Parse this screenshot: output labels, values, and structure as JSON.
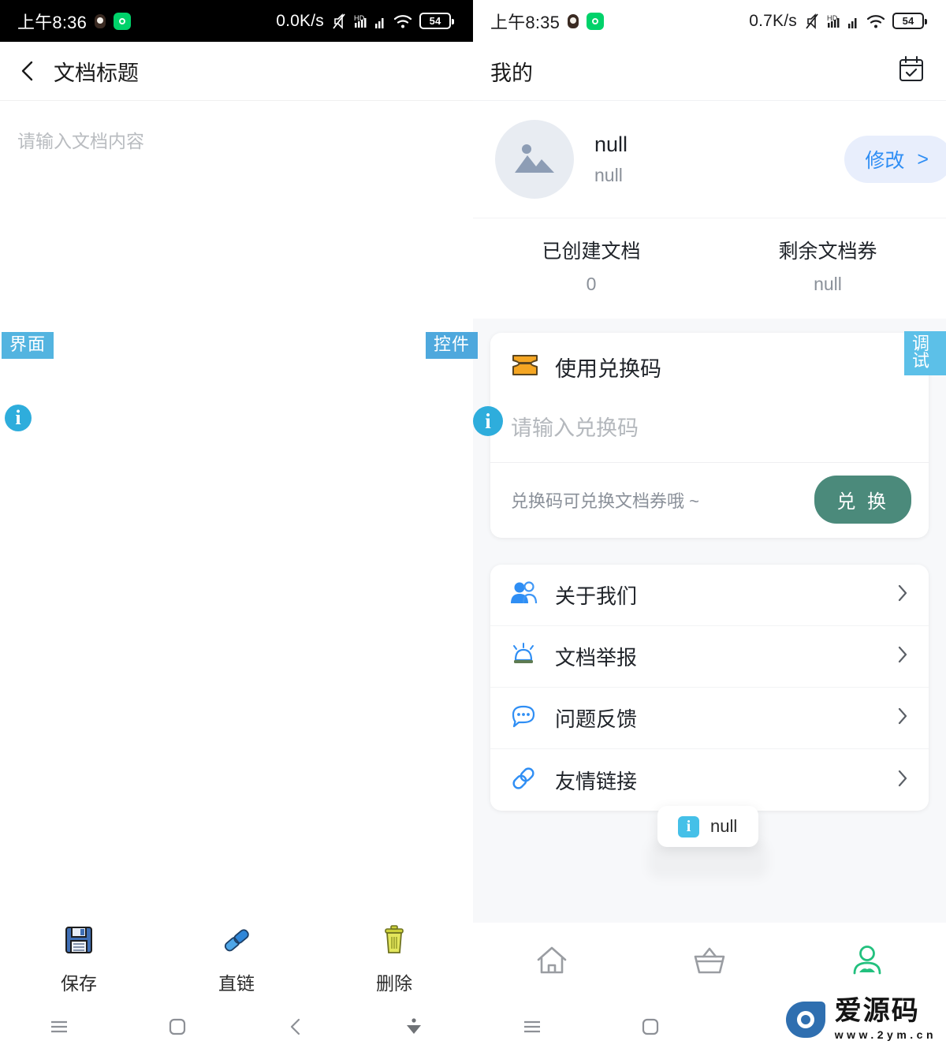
{
  "left_phone": {
    "status_bar": {
      "time": "上午8:36",
      "speed": "0.0K/s",
      "battery": "54",
      "network": "HD",
      "icons": [
        "qq-icon",
        "green-shield-icon",
        "mute-icon",
        "hd-icon",
        "signal-icon",
        "wifi-icon",
        "battery-icon"
      ]
    },
    "header": {
      "back_icon": "back-chevron-icon",
      "title": "文档标题"
    },
    "editor": {
      "placeholder": "请输入文档内容"
    },
    "badges": {
      "interface": "界面",
      "widget": "控件"
    },
    "toolbar": [
      {
        "label": "保存",
        "icon": "floppy-disk-icon"
      },
      {
        "label": "直链",
        "icon": "chain-link-icon"
      },
      {
        "label": "删除",
        "icon": "trash-can-icon"
      }
    ],
    "navbar": [
      "menu-icon",
      "home-square-icon",
      "back-icon",
      "keyboard-hide-icon"
    ]
  },
  "right_phone": {
    "status_bar": {
      "time": "上午8:35",
      "speed": "0.7K/s",
      "battery": "54",
      "network": "HD"
    },
    "header": {
      "title": "我的",
      "action_icon": "calendar-check-icon"
    },
    "profile": {
      "avatar_icon": "image-placeholder-icon",
      "name": "null",
      "subtitle": "null",
      "edit_label": "修改",
      "edit_chevron": ">"
    },
    "stats": [
      {
        "label": "已创建文档",
        "value": "0"
      },
      {
        "label": "剩余文档券",
        "value": "null"
      }
    ],
    "redeem_card": {
      "icon": "ticket-icon",
      "title": "使用兑换码",
      "input_placeholder": "请输入兑换码",
      "hint": "兑换码可兑换文档券哦 ~",
      "button_label": "兑 换"
    },
    "menu": [
      {
        "label": "关于我们",
        "icon": "people-icon"
      },
      {
        "label": "文档举报",
        "icon": "alarm-light-icon"
      },
      {
        "label": "问题反馈",
        "icon": "chat-bubble-icon"
      },
      {
        "label": "友情链接",
        "icon": "link-icon"
      }
    ],
    "toast": {
      "icon": "info-square-icon",
      "text": "null"
    },
    "tabbar": [
      {
        "icon": "home-icon",
        "active": false
      },
      {
        "icon": "basket-icon",
        "active": false
      },
      {
        "icon": "person-icon",
        "active": true
      }
    ],
    "badge_debug": "调试",
    "navbar": [
      "menu-icon",
      "home-square-icon"
    ]
  },
  "watermark": {
    "title": "爱源码",
    "url": "www.2ym.cn"
  },
  "colors": {
    "badge_blue": "#53b4e0",
    "info_cyan": "#2eaddc",
    "redeem_green": "#4b8a7b",
    "edit_pill_bg": "#e8eefc",
    "edit_pill_text": "#2f8ef4",
    "tab_active": "#22c07e"
  }
}
